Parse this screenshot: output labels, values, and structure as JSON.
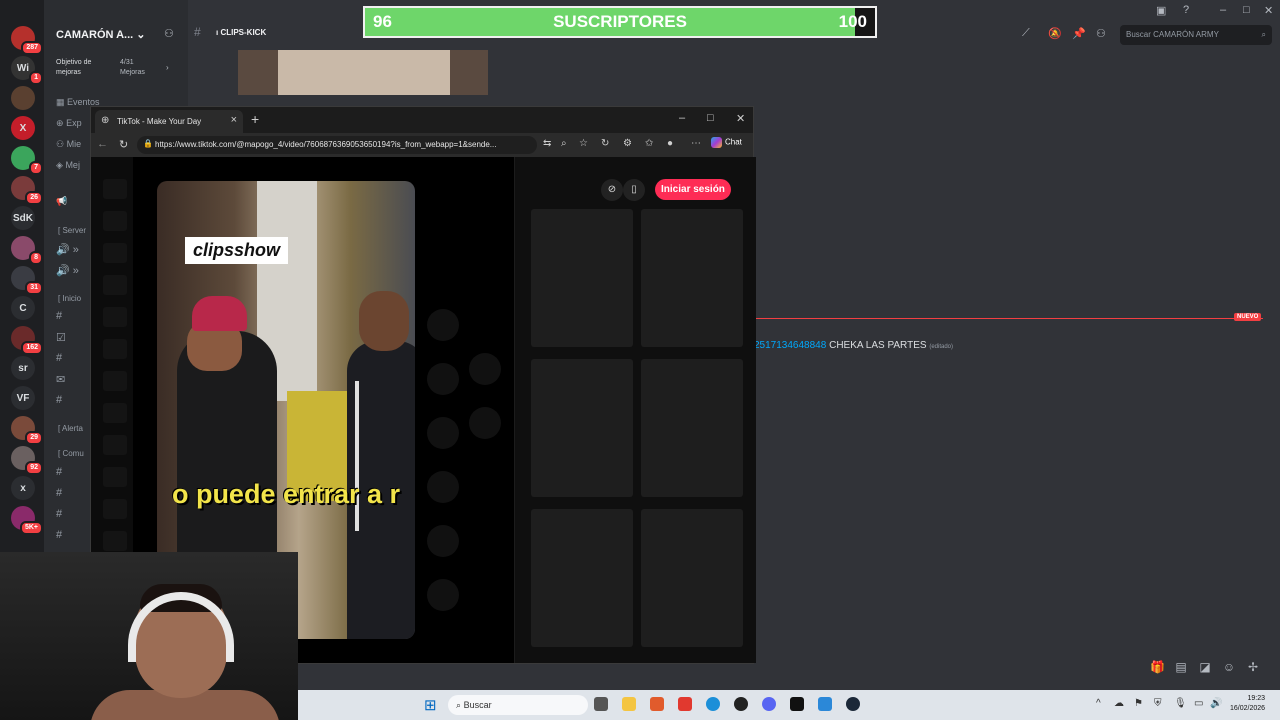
{
  "discord": {
    "guild_name": "CAMARÓN A...",
    "boost_goal_label": "Objetivo de mejoras",
    "boost_count": "4/31 Mejoras",
    "nav": [
      "Eventos",
      "Exp",
      "Mie",
      "Mej"
    ],
    "categories": [
      "Server",
      "Inicio",
      "Alerta",
      "Comu"
    ],
    "channel_title": "CLIPS-KICK",
    "search_placeholder": "Buscar CAMARÓN ARMY",
    "new_tag": "NUEVO",
    "message": {
      "link": "2517134648848",
      "text": "CHEKA LAS PARTES",
      "edited": "(editado)"
    },
    "servers": [
      {
        "label": "",
        "badge": "287"
      },
      {
        "label": "Wi",
        "badge": "1"
      },
      {
        "label": "",
        "badge": ""
      },
      {
        "label": "X",
        "badge": ""
      },
      {
        "label": "",
        "badge": "7"
      },
      {
        "label": "",
        "badge": "26"
      },
      {
        "label": "SdK",
        "badge": ""
      },
      {
        "label": "",
        "badge": "8"
      },
      {
        "label": "",
        "badge": "31"
      },
      {
        "label": "C",
        "badge": ""
      },
      {
        "label": "",
        "badge": "162"
      },
      {
        "label": "sr",
        "badge": ""
      },
      {
        "label": "VF",
        "badge": ""
      },
      {
        "label": "",
        "badge": "29"
      },
      {
        "label": "",
        "badge": "92"
      },
      {
        "label": "x",
        "badge": ""
      },
      {
        "label": "",
        "badge": "5K+"
      }
    ]
  },
  "overlay": {
    "current": "96",
    "title": "SUSCRIPTORES",
    "goal": "100",
    "progress_fraction": 0.96,
    "fill_color": "#6ed66a"
  },
  "browser": {
    "tab_title": "TikTok - Make Your Day",
    "url": "https://www.tiktok.com/@mapogo_4/video/7606876369053650194?is_from_webapp=1&sende...",
    "chat_label": "Chat",
    "login_label": "Iniciar sesión",
    "login_color": "#fe2c55",
    "video_logo": "clipsshow",
    "video_caption": "o puede entrar a r"
  },
  "taskbar": {
    "search_label": "Buscar",
    "time": "19:23",
    "date": "16/02/2026"
  }
}
